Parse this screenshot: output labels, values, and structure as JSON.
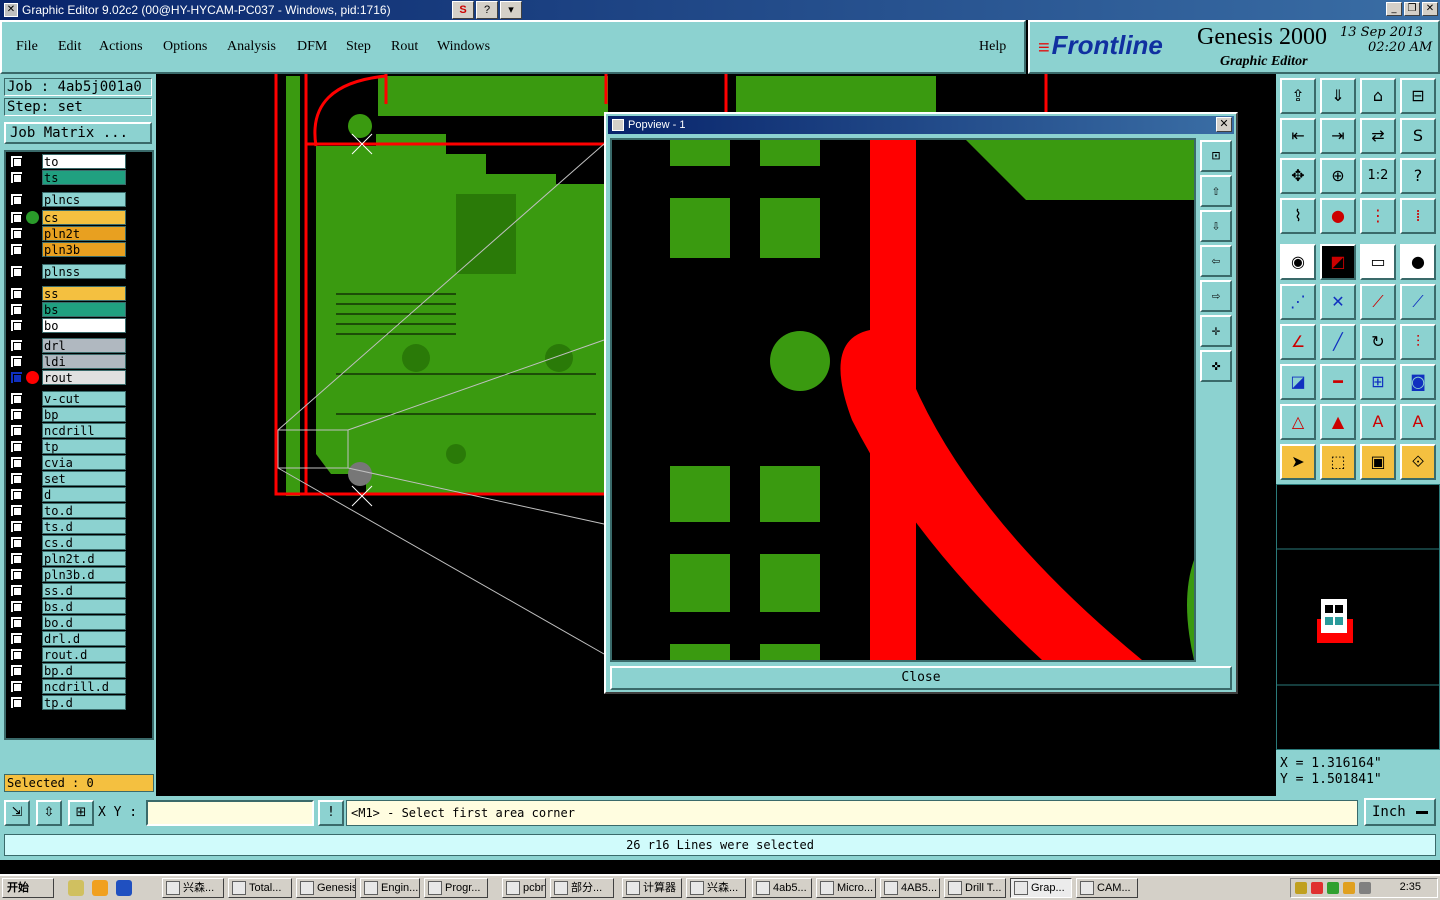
{
  "window": {
    "title": "Graphic Editor 9.02c2 (00@HY-HYCAM-PC037 - Windows, pid:1716)",
    "title_tools": [
      "S",
      "?",
      "▾"
    ],
    "controls": [
      "_",
      "❐",
      "✕"
    ]
  },
  "menu": {
    "items": [
      "File",
      "Edit",
      "Actions",
      "Options",
      "Analysis",
      "DFM",
      "Step",
      "Rout",
      "Windows"
    ],
    "help": "Help"
  },
  "brand": {
    "logo": "Frontline",
    "product": "Genesis 2000",
    "subtitle": "Graphic Editor",
    "date": "13 Sep 2013",
    "time": "02:20 AM"
  },
  "job": {
    "job_label": "Job : 4ab5j001a0",
    "step_label": "Step: set",
    "matrix_button": "Job Matrix ..."
  },
  "layers": [
    {
      "name": "to",
      "color": "#ffffff",
      "dot": ""
    },
    {
      "name": "ts",
      "color": "#20a080",
      "dot": ""
    },
    {
      "name": "plncs",
      "color": "#8cd2d0",
      "dot": ""
    },
    {
      "name": "cs",
      "color": "#f4c040",
      "dot": "#2a9a2a"
    },
    {
      "name": "pln2t",
      "color": "#e8a020",
      "dot": ""
    },
    {
      "name": "pln3b",
      "color": "#e8a020",
      "dot": ""
    },
    {
      "name": "plnss",
      "color": "#8cd2d0",
      "dot": ""
    },
    {
      "name": "ss",
      "color": "#f4c040",
      "dot": ""
    },
    {
      "name": "bs",
      "color": "#20a080",
      "dot": ""
    },
    {
      "name": "bo",
      "color": "#ffffff",
      "dot": ""
    },
    {
      "name": "drl",
      "color": "#b0b8c0",
      "dot": ""
    },
    {
      "name": "ldi",
      "color": "#b0b8c0",
      "dot": ""
    },
    {
      "name": "rout",
      "color": "#e0e0e0",
      "dot": "#ff0000"
    },
    {
      "name": "v-cut",
      "color": "#8cd2d0",
      "dot": ""
    },
    {
      "name": "bp",
      "color": "#8cd2d0",
      "dot": ""
    },
    {
      "name": "ncdrill",
      "color": "#8cd2d0",
      "dot": ""
    },
    {
      "name": "tp",
      "color": "#8cd2d0",
      "dot": ""
    },
    {
      "name": "cvia",
      "color": "#8cd2d0",
      "dot": ""
    },
    {
      "name": "set",
      "color": "#8cd2d0",
      "dot": ""
    },
    {
      "name": "d",
      "color": "#8cd2d0",
      "dot": ""
    },
    {
      "name": "to.d",
      "color": "#8cd2d0",
      "dot": ""
    },
    {
      "name": "ts.d",
      "color": "#8cd2d0",
      "dot": ""
    },
    {
      "name": "cs.d",
      "color": "#8cd2d0",
      "dot": ""
    },
    {
      "name": "pln2t.d",
      "color": "#8cd2d0",
      "dot": ""
    },
    {
      "name": "pln3b.d",
      "color": "#8cd2d0",
      "dot": ""
    },
    {
      "name": "ss.d",
      "color": "#8cd2d0",
      "dot": ""
    },
    {
      "name": "bs.d",
      "color": "#8cd2d0",
      "dot": ""
    },
    {
      "name": "bo.d",
      "color": "#8cd2d0",
      "dot": ""
    },
    {
      "name": "drl.d",
      "color": "#8cd2d0",
      "dot": ""
    },
    {
      "name": "rout.d",
      "color": "#8cd2d0",
      "dot": ""
    },
    {
      "name": "bp.d",
      "color": "#8cd2d0",
      "dot": ""
    },
    {
      "name": "ncdrill.d",
      "color": "#8cd2d0",
      "dot": ""
    },
    {
      "name": "tp.d",
      "color": "#8cd2d0",
      "dot": ""
    }
  ],
  "selected": "Selected : 0",
  "popview": {
    "title": "Popview - 1",
    "close_label": "Close",
    "tool_icons": [
      "zoom-fit-icon",
      "pan-up-icon",
      "pan-down-icon",
      "pan-left-icon",
      "pan-right-icon",
      "zoom-in-icon",
      "zoom-out-icon"
    ]
  },
  "coords": {
    "x": "X = 1.316164\"",
    "y": "Y = 1.501841\""
  },
  "command": {
    "xy_label": "X Y :",
    "xy_value": "",
    "prompt": "<M1> - Select first area corner",
    "units": "Inch"
  },
  "status": "26 r16 Lines were selected",
  "taskbar": {
    "start": "开始",
    "tasks": [
      "兴森...",
      "Total...",
      "Genesis",
      "Engin...",
      "Progr...",
      "pcbn...",
      "部分...",
      "计算器",
      "兴森...",
      "4ab5...",
      "Micro...",
      "4AB5...",
      "Drill T...",
      "Grap...",
      "CAM..."
    ],
    "active_task": "Grap...",
    "clock": "2:35"
  },
  "colors": {
    "panel": "#8cd2d0",
    "copper": "#3a9a10",
    "rout": "#ff0000"
  }
}
